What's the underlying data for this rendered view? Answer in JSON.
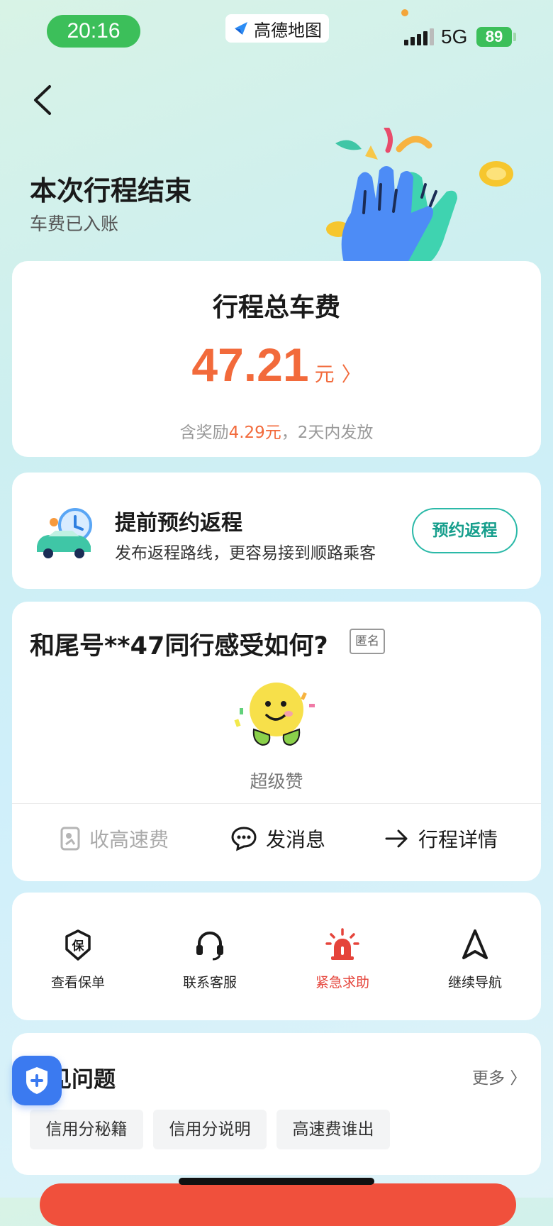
{
  "status_bar": {
    "time": "20:16",
    "app_name": "高德地图",
    "network": "5G",
    "battery": "89"
  },
  "header": {
    "title": "本次行程结束",
    "subtitle": "车费已入账"
  },
  "fare": {
    "title": "行程总车费",
    "amount": "47.21",
    "unit": "元",
    "note_prefix": "含奖励",
    "reward": "4.29元",
    "note_suffix": "，2天内发放"
  },
  "return_trip": {
    "title": "提前预约返程",
    "description": "发布返程路线，更容易接到顺路乘客",
    "button": "预约返程"
  },
  "rating": {
    "question": "和尾号**47同行感受如何?",
    "anon_badge": "匿名",
    "emoji_label": "超级赞"
  },
  "actions": [
    {
      "label": "收高速费",
      "icon": "toll-icon",
      "disabled": true
    },
    {
      "label": "发消息",
      "icon": "message-icon",
      "disabled": false
    },
    {
      "label": "行程详情",
      "icon": "arrow-right-icon",
      "disabled": false
    }
  ],
  "services": [
    {
      "label": "查看保单",
      "icon": "insurance-icon"
    },
    {
      "label": "联系客服",
      "icon": "headset-icon"
    },
    {
      "label": "紧急求助",
      "icon": "siren-icon",
      "color": "#e5443b"
    },
    {
      "label": "继续导航",
      "icon": "navigation-icon"
    }
  ],
  "faq": {
    "title": "见问题",
    "more": "更多",
    "tags": [
      "信用分秘籍",
      "信用分说明",
      "高速费谁出"
    ]
  },
  "colors": {
    "accent": "#f26a3b",
    "teal": "#2bb9a8",
    "danger": "#e5443b",
    "status_green": "#3cbf5a"
  }
}
